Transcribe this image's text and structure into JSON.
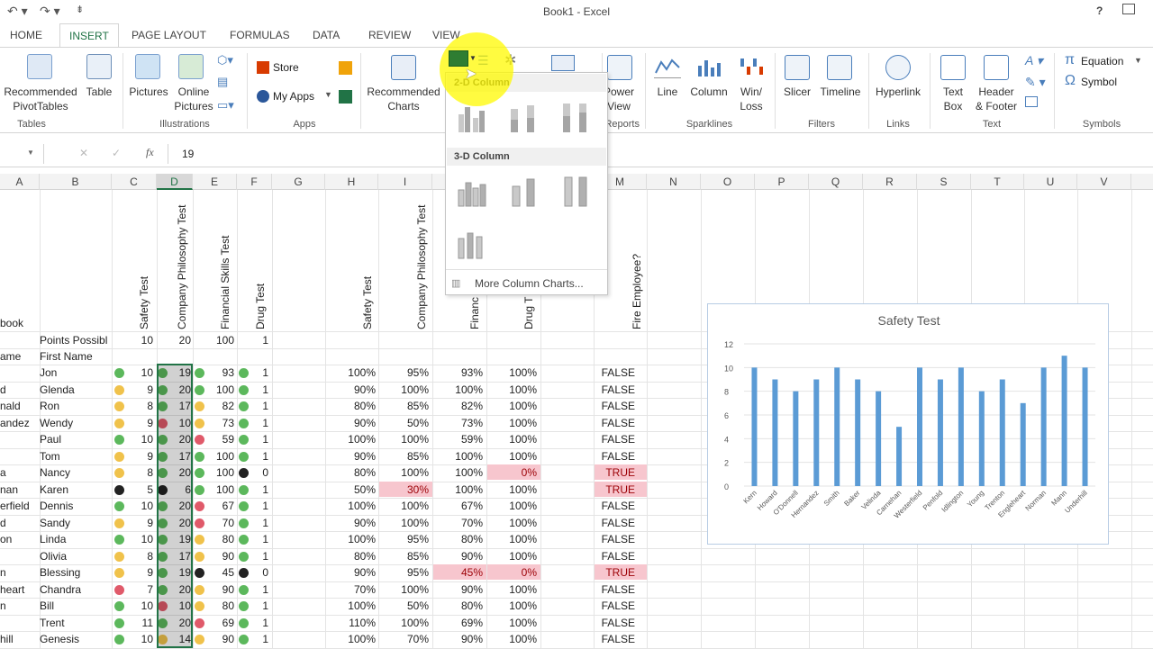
{
  "window": {
    "title": "Book1 - Excel",
    "help": "?"
  },
  "tabs": [
    "HOME",
    "INSERT",
    "PAGE LAYOUT",
    "FORMULAS",
    "DATA",
    "REVIEW",
    "VIEW"
  ],
  "ribbon": {
    "tables": {
      "group": "Tables",
      "recommended": "Recommended\nPivotTables",
      "table": "Table"
    },
    "illustrations": {
      "group": "Illustrations",
      "pictures": "Pictures",
      "online": "Online\nPictures"
    },
    "apps": {
      "group": "Apps",
      "store": "Store",
      "myapps": "My Apps"
    },
    "charts": {
      "recommended": "Recommended\nCharts"
    },
    "reports": {
      "group": "Reports",
      "power": "Power\nView"
    },
    "sparklines": {
      "group": "Sparklines",
      "line": "Line",
      "column": "Column",
      "winloss": "Win/\nLoss"
    },
    "filters": {
      "group": "Filters",
      "slicer": "Slicer",
      "timeline": "Timeline"
    },
    "links": {
      "group": "Links",
      "hyperlink": "Hyperlink"
    },
    "text": {
      "group": "Text",
      "textbox": "Text\nBox",
      "header": "Header\n& Footer"
    },
    "symbols": {
      "group": "Symbols",
      "equation": "Equation",
      "symbol": "Symbol"
    }
  },
  "formula_bar": {
    "value": "19",
    "fx": "fx"
  },
  "columns": [
    "A",
    "B",
    "C",
    "D",
    "E",
    "F",
    "G",
    "H",
    "I",
    "J",
    "K",
    "L",
    "M",
    "N",
    "O",
    "P",
    "Q",
    "R",
    "S",
    "T",
    "U",
    "V"
  ],
  "headers": {
    "book": "book",
    "safety": "Safety Test",
    "philosophy": "Company Philosophy Test",
    "financial": "Financial Skills Test",
    "drug": "Drug Test",
    "safety2": "Safety Test",
    "philosophy2": "Company Philosophy Test",
    "financial2": "Financ",
    "drug2": "Drug T",
    "fire": "Fire Employee?"
  },
  "points_label": "Points Possibl",
  "first_name": "First Name",
  "name_col": "ame",
  "points": {
    "c": "10",
    "d": "20",
    "e": "100",
    "f": "1"
  },
  "rows": [
    {
      "a": "",
      "b": "Jon",
      "c": "10",
      "d": "19",
      "e": "93",
      "f": "1",
      "h": "100%",
      "i": "95%",
      "j": "93%",
      "k": "100%",
      "m": "FALSE",
      "dc": "#5cb85c",
      "dd": "#5cb85c",
      "de": "#5cb85c",
      "df": "#5cb85c"
    },
    {
      "a": "d",
      "b": "Glenda",
      "c": "9",
      "d": "20",
      "e": "100",
      "f": "1",
      "h": "90%",
      "i": "100%",
      "j": "100%",
      "k": "100%",
      "m": "FALSE",
      "dc": "#f0c24b",
      "dd": "#5cb85c",
      "de": "#5cb85c",
      "df": "#5cb85c"
    },
    {
      "a": "nald",
      "b": "Ron",
      "c": "8",
      "d": "17",
      "e": "82",
      "f": "1",
      "h": "80%",
      "i": "85%",
      "j": "82%",
      "k": "100%",
      "m": "FALSE",
      "dc": "#f0c24b",
      "dd": "#5cb85c",
      "de": "#f0c24b",
      "df": "#5cb85c"
    },
    {
      "a": "andez",
      "b": "Wendy",
      "c": "9",
      "d": "10",
      "e": "73",
      "f": "1",
      "h": "90%",
      "i": "50%",
      "j": "73%",
      "k": "100%",
      "m": "FALSE",
      "dc": "#f0c24b",
      "dd": "#e05a6a",
      "de": "#f0c24b",
      "df": "#5cb85c"
    },
    {
      "a": "",
      "b": "Paul",
      "c": "10",
      "d": "20",
      "e": "59",
      "f": "1",
      "h": "100%",
      "i": "100%",
      "j": "59%",
      "k": "100%",
      "m": "FALSE",
      "dc": "#5cb85c",
      "dd": "#5cb85c",
      "de": "#e05a6a",
      "df": "#5cb85c"
    },
    {
      "a": "",
      "b": "Tom",
      "c": "9",
      "d": "17",
      "e": "100",
      "f": "1",
      "h": "90%",
      "i": "85%",
      "j": "100%",
      "k": "100%",
      "m": "FALSE",
      "dc": "#f0c24b",
      "dd": "#5cb85c",
      "de": "#5cb85c",
      "df": "#5cb85c"
    },
    {
      "a": "a",
      "b": "Nancy",
      "c": "8",
      "d": "20",
      "e": "100",
      "f": "0",
      "h": "80%",
      "i": "100%",
      "j": "100%",
      "k": "0%",
      "m": "TRUE",
      "dc": "#f0c24b",
      "dd": "#5cb85c",
      "de": "#5cb85c",
      "df": "#222"
    },
    {
      "a": "nan",
      "b": "Karen",
      "c": "5",
      "d": "6",
      "e": "100",
      "f": "1",
      "h": "50%",
      "i": "30%",
      "j": "100%",
      "k": "100%",
      "m": "TRUE",
      "dc": "#222",
      "dd": "#222",
      "de": "#5cb85c",
      "df": "#5cb85c"
    },
    {
      "a": "erfield",
      "b": "Dennis",
      "c": "10",
      "d": "20",
      "e": "67",
      "f": "1",
      "h": "100%",
      "i": "100%",
      "j": "67%",
      "k": "100%",
      "m": "FALSE",
      "dc": "#5cb85c",
      "dd": "#5cb85c",
      "de": "#e05a6a",
      "df": "#5cb85c"
    },
    {
      "a": "d",
      "b": "Sandy",
      "c": "9",
      "d": "20",
      "e": "70",
      "f": "1",
      "h": "90%",
      "i": "100%",
      "j": "70%",
      "k": "100%",
      "m": "FALSE",
      "dc": "#f0c24b",
      "dd": "#5cb85c",
      "de": "#e05a6a",
      "df": "#5cb85c"
    },
    {
      "a": "on",
      "b": "Linda",
      "c": "10",
      "d": "19",
      "e": "80",
      "f": "1",
      "h": "100%",
      "i": "95%",
      "j": "80%",
      "k": "100%",
      "m": "FALSE",
      "dc": "#5cb85c",
      "dd": "#5cb85c",
      "de": "#f0c24b",
      "df": "#5cb85c"
    },
    {
      "a": "",
      "b": "Olivia",
      "c": "8",
      "d": "17",
      "e": "90",
      "f": "1",
      "h": "80%",
      "i": "85%",
      "j": "90%",
      "k": "100%",
      "m": "FALSE",
      "dc": "#f0c24b",
      "dd": "#5cb85c",
      "de": "#f0c24b",
      "df": "#5cb85c"
    },
    {
      "a": "n",
      "b": "Blessing",
      "c": "9",
      "d": "19",
      "e": "45",
      "f": "0",
      "h": "90%",
      "i": "95%",
      "j": "45%",
      "k": "0%",
      "m": "TRUE",
      "dc": "#f0c24b",
      "dd": "#5cb85c",
      "de": "#222",
      "df": "#222"
    },
    {
      "a": "heart",
      "b": "Chandra",
      "c": "7",
      "d": "20",
      "e": "90",
      "f": "1",
      "h": "70%",
      "i": "100%",
      "j": "90%",
      "k": "100%",
      "m": "FALSE",
      "dc": "#e05a6a",
      "dd": "#5cb85c",
      "de": "#f0c24b",
      "df": "#5cb85c"
    },
    {
      "a": "n",
      "b": "Bill",
      "c": "10",
      "d": "10",
      "e": "80",
      "f": "1",
      "h": "100%",
      "i": "50%",
      "j": "80%",
      "k": "100%",
      "m": "FALSE",
      "dc": "#5cb85c",
      "dd": "#e05a6a",
      "de": "#f0c24b",
      "df": "#5cb85c"
    },
    {
      "a": "",
      "b": "Trent",
      "c": "11",
      "d": "20",
      "e": "69",
      "f": "1",
      "h": "110%",
      "i": "100%",
      "j": "69%",
      "k": "100%",
      "m": "FALSE",
      "dc": "#5cb85c",
      "dd": "#5cb85c",
      "de": "#e05a6a",
      "df": "#5cb85c"
    },
    {
      "a": "hill",
      "b": "Genesis",
      "c": "10",
      "d": "14",
      "e": "90",
      "f": "1",
      "h": "100%",
      "i": "70%",
      "j": "90%",
      "k": "100%",
      "m": "FALSE",
      "dc": "#5cb85c",
      "dd": "#f0c24b",
      "de": "#f0c24b",
      "df": "#5cb85c"
    }
  ],
  "pink_cells": [
    [
      6,
      "k"
    ],
    [
      6,
      "m"
    ],
    [
      7,
      "i"
    ],
    [
      7,
      "m"
    ],
    [
      12,
      "j"
    ],
    [
      12,
      "k"
    ],
    [
      12,
      "m"
    ]
  ],
  "dropdown": {
    "sec2d": "2-D Column",
    "sec3d": "3-D Column",
    "more": "More Column Charts..."
  },
  "chart_data": {
    "type": "bar",
    "title": "Safety Test",
    "categories": [
      "Kern",
      "Howard",
      "O'Donnell",
      "Hernandez",
      "Smith",
      "Baker",
      "Velinda",
      "Carnehan",
      "Westerfield",
      "Penfold",
      "Idlington",
      "Young",
      "Trenton",
      "Engleheart",
      "Norman",
      "Mann",
      "Underhill"
    ],
    "values": [
      10,
      9,
      8,
      9,
      10,
      9,
      8,
      5,
      10,
      9,
      10,
      8,
      9,
      7,
      10,
      11,
      10
    ],
    "ylim": [
      0,
      12
    ],
    "yticks": [
      0,
      2,
      4,
      6,
      8,
      10,
      12
    ],
    "color": "#5b9bd5",
    "grid": true
  }
}
